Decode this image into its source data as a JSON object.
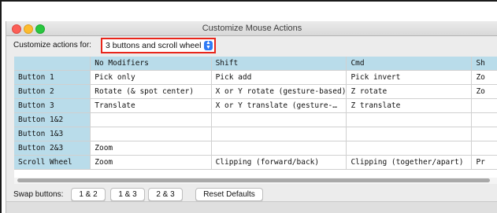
{
  "window": {
    "title": "Customize Mouse Actions"
  },
  "toolbar": {
    "label": "Customize actions for:",
    "selected": "3 buttons and scroll wheel"
  },
  "table": {
    "headers": [
      "",
      "No Modifiers",
      "Shift",
      "Cmd",
      "Sh"
    ],
    "rows": [
      {
        "label": "Button 1",
        "cells": [
          "Pick only",
          "Pick add",
          "Pick invert",
          "Zo"
        ]
      },
      {
        "label": "Button 2",
        "cells": [
          "Rotate (& spot center)",
          "X or Y rotate (gesture-based)",
          "Z rotate",
          "Zo"
        ]
      },
      {
        "label": "Button 3",
        "cells": [
          "Translate",
          "X or Y translate (gesture-…",
          "Z translate",
          ""
        ]
      },
      {
        "label": "Button 1&2",
        "cells": [
          "",
          "",
          "",
          ""
        ]
      },
      {
        "label": "Button 1&3",
        "cells": [
          "",
          "",
          "",
          ""
        ]
      },
      {
        "label": "Button 2&3",
        "cells": [
          "Zoom",
          "",
          "",
          ""
        ]
      },
      {
        "label": "Scroll Wheel",
        "cells": [
          "Zoom",
          "Clipping (forward/back)",
          "Clipping (together/apart)",
          "Pr"
        ]
      }
    ]
  },
  "swap": {
    "label": "Swap buttons:",
    "buttons": [
      "1 & 2",
      "1 & 3",
      "2 & 3"
    ]
  },
  "reset_label": "Reset Defaults"
}
